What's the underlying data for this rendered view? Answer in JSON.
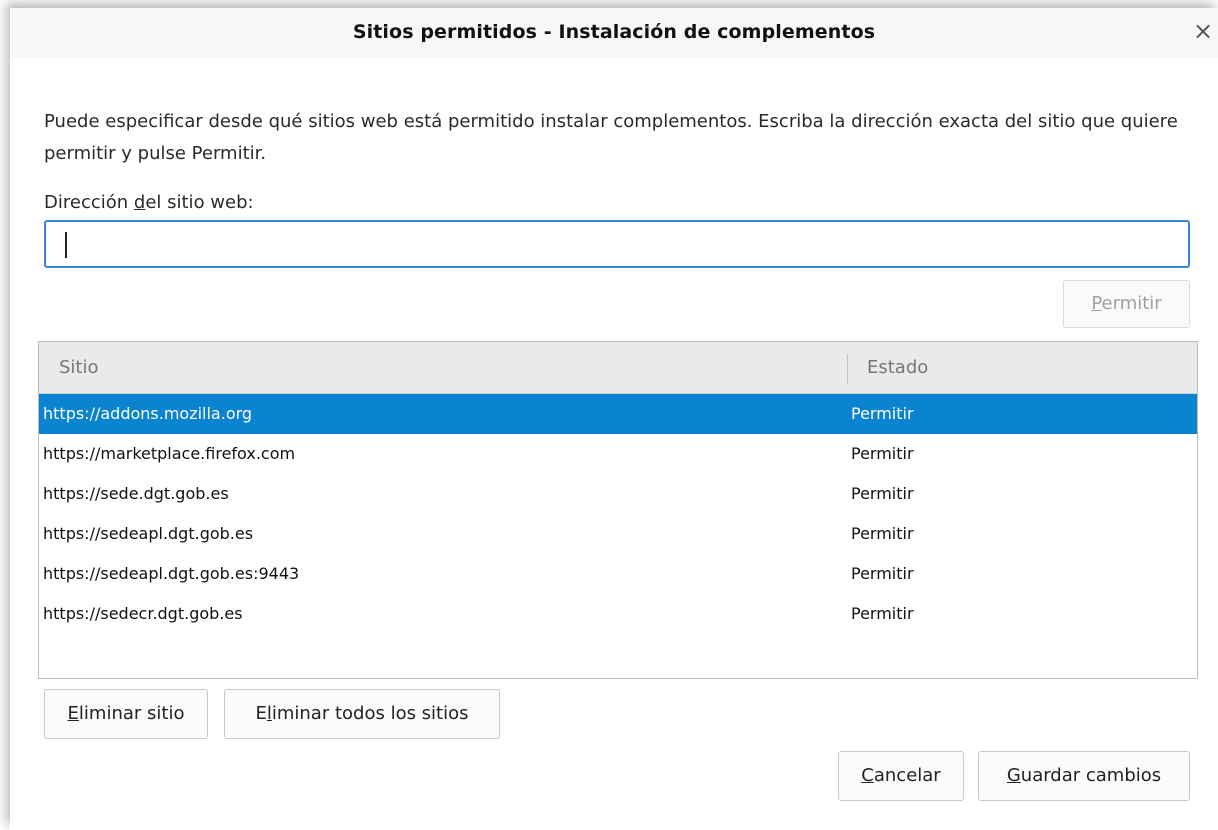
{
  "dialog": {
    "title": "Sitios permitidos - Instalación de complementos",
    "close_glyph": "×"
  },
  "description": "Puede especificar desde qué sitios web está permitido instalar complementos. Escriba la dirección exacta del sitio que quiere permitir y pulse Permitir.",
  "address": {
    "label_before": "Dirección ",
    "label_accel": "d",
    "label_after": "el sitio web:",
    "value": "",
    "placeholder": ""
  },
  "allow_button": {
    "accel": "P",
    "rest": "ermitir"
  },
  "table": {
    "columns": [
      "Sitio",
      "Estado"
    ],
    "rows": [
      {
        "site": "https://addons.mozilla.org",
        "status": "Permitir",
        "selected": true
      },
      {
        "site": "https://marketplace.firefox.com",
        "status": "Permitir",
        "selected": false
      },
      {
        "site": "https://sede.dgt.gob.es",
        "status": "Permitir",
        "selected": false
      },
      {
        "site": "https://sedeapl.dgt.gob.es",
        "status": "Permitir",
        "selected": false
      },
      {
        "site": "https://sedeapl.dgt.gob.es:9443",
        "status": "Permitir",
        "selected": false
      },
      {
        "site": "https://sedecr.dgt.gob.es",
        "status": "Permitir",
        "selected": false
      }
    ]
  },
  "buttons": {
    "remove_site": {
      "accel": "E",
      "rest": "liminar sitio"
    },
    "remove_all": {
      "before": "E",
      "accel": "l",
      "rest": "iminar todos los sitios"
    },
    "cancel": {
      "accel": "C",
      "rest": "ancelar"
    },
    "save": {
      "accel": "G",
      "rest": "uardar cambios"
    }
  },
  "colors": {
    "selection": "#0a84d0",
    "focus_border": "#3b86d6"
  },
  "icons": {
    "close": "close-icon"
  }
}
